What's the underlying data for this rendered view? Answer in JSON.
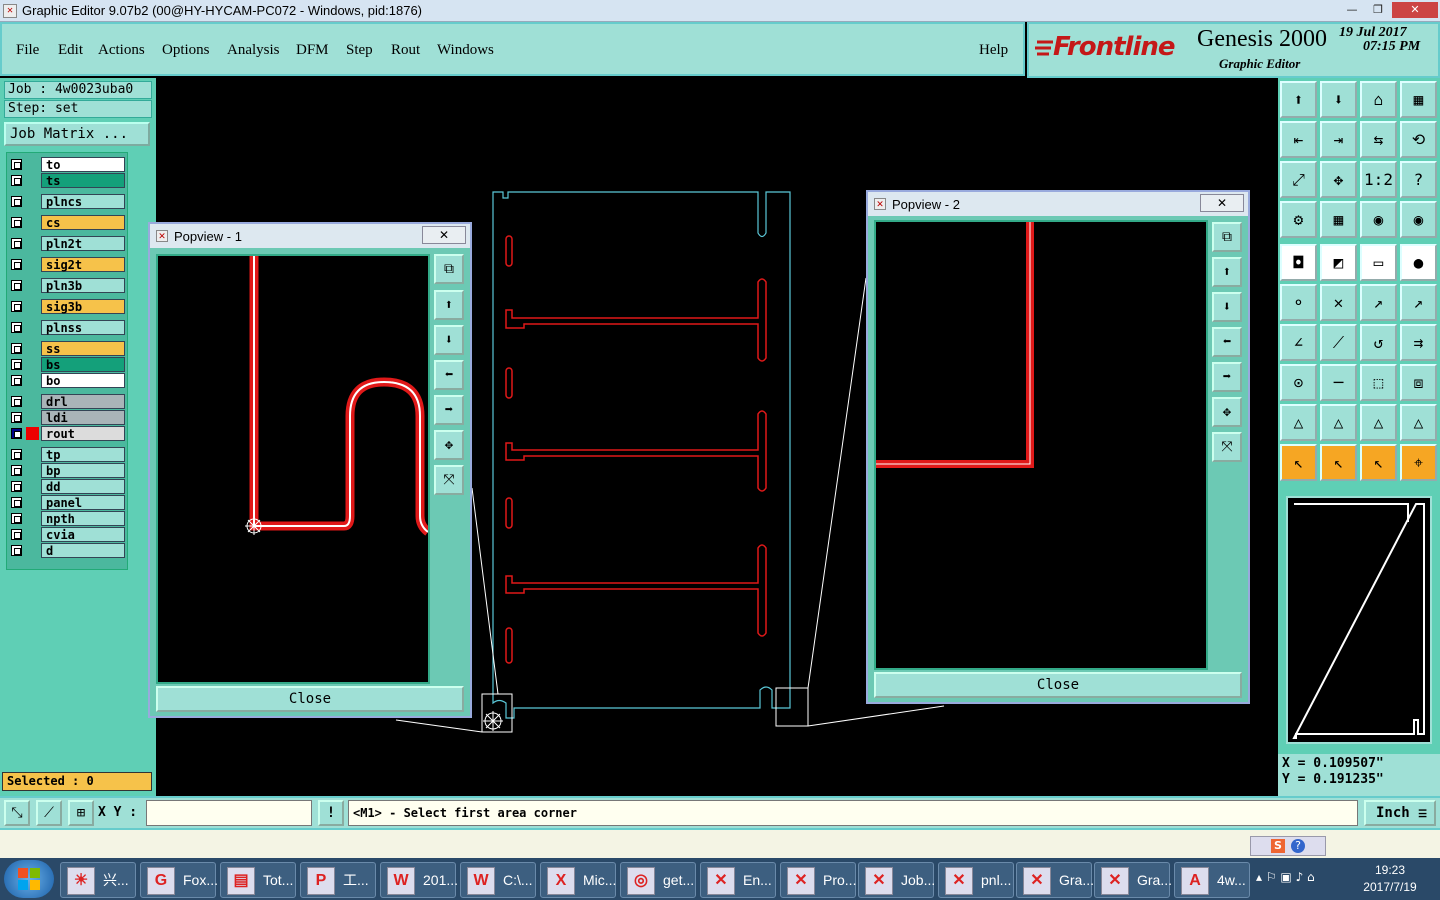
{
  "window": {
    "title": "Graphic Editor 9.07b2 (00@HY-HYCAM-PC072 - Windows, pid:1876)",
    "minimize": "—",
    "restore": "❐",
    "close": "✕"
  },
  "menu": {
    "items": [
      "File",
      "Edit",
      "Actions",
      "Options",
      "Analysis",
      "DFM",
      "Step",
      "Rout",
      "Windows"
    ],
    "help": "Help"
  },
  "logo": {
    "brand": "Frontline",
    "product": "Genesis 2000",
    "subtitle": "Graphic Editor",
    "date": "19 Jul 2017",
    "time": "07:15 PM"
  },
  "left": {
    "job": "Job : 4w0023uba0",
    "step": "Step: set",
    "job_matrix": "Job Matrix ...",
    "selected": "Selected : 0",
    "layers": [
      {
        "name": "to",
        "color": "#ffffff"
      },
      {
        "name": "ts",
        "color": "#14a07a"
      },
      {
        "name": "plncs",
        "color": "#9fe0d6"
      },
      {
        "name": "cs",
        "color": "#f6c24a"
      },
      {
        "name": "pln2t",
        "color": "#9fe0d6"
      },
      {
        "name": "sig2t",
        "color": "#f6c24a"
      },
      {
        "name": "pln3b",
        "color": "#9fe0d6"
      },
      {
        "name": "sig3b",
        "color": "#f6c24a"
      },
      {
        "name": "plnss",
        "color": "#9fe0d6"
      },
      {
        "name": "ss",
        "color": "#f6c24a"
      },
      {
        "name": "bs",
        "color": "#14a07a"
      },
      {
        "name": "bo",
        "color": "#ffffff"
      },
      {
        "name": "drl",
        "color": "#a9b4b8"
      },
      {
        "name": "ldi",
        "color": "#a9b4b8"
      },
      {
        "name": "rout",
        "color": "#dcdcdc"
      },
      {
        "name": "tp",
        "color": "#9fe0d6"
      },
      {
        "name": "bp",
        "color": "#9fe0d6"
      },
      {
        "name": "dd",
        "color": "#9fe0d6"
      },
      {
        "name": "panel",
        "color": "#9fe0d6"
      },
      {
        "name": "npth",
        "color": "#9fe0d6"
      },
      {
        "name": "cvia",
        "color": "#9fe0d6"
      },
      {
        "name": "d",
        "color": "#9fe0d6"
      }
    ]
  },
  "popview1": {
    "title": "Popview - 1",
    "close": "Close",
    "x": "✕"
  },
  "popview2": {
    "title": "Popview - 2",
    "close": "Close",
    "x": "✕"
  },
  "coords": {
    "x": "X = 0.109507\"",
    "y": "Y = 0.191235\""
  },
  "cmd": {
    "xy_label": "X Y :",
    "xy_value": "",
    "message": "<M1> - Select first area corner",
    "units": "Inch",
    "warn": "!"
  },
  "taskbar": {
    "items": [
      "兴...",
      "Fox...",
      "Tot...",
      "工...",
      "201...",
      "C:\\...",
      "Mic...",
      "get...",
      "En...",
      "Pro...",
      "Job...",
      "pnl...",
      "Gra...",
      "Gra...",
      "4w..."
    ],
    "time": "19:23",
    "date": "2017/7/19"
  }
}
